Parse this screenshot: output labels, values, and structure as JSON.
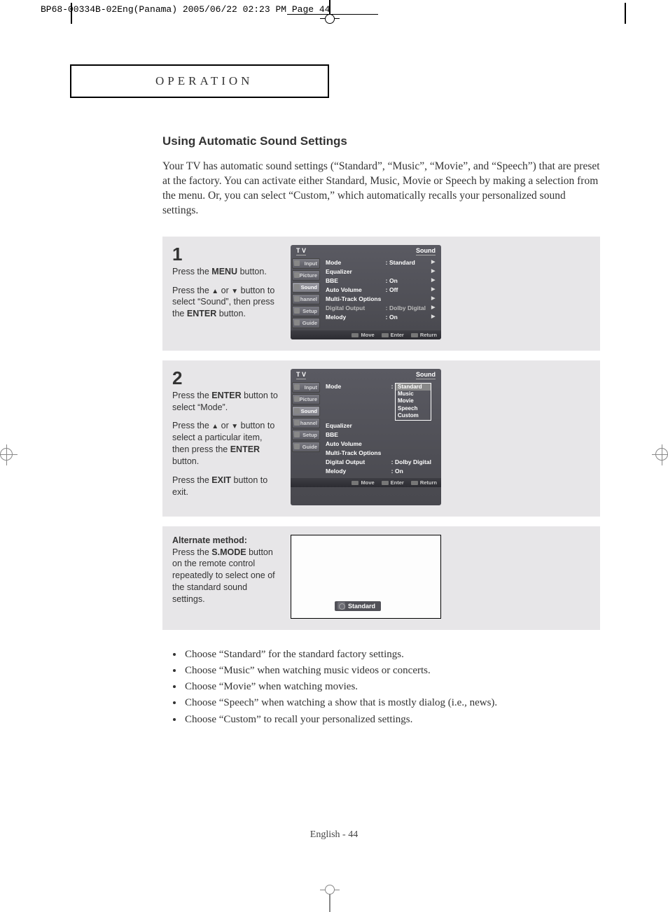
{
  "crop_header": "BP68-00334B-02Eng(Panama)  2005/06/22  02:23 PM  Page 44",
  "section_title": "OPERATION",
  "heading": "Using Automatic Sound Settings",
  "intro": "Your TV has automatic sound settings (“Standard”, “Music”, “Movie”, and “Speech”)  that are preset at the factory.  You can activate either Standard, Music, Movie or Speech by making a selection from the menu. Or, you can select “Custom,” which automatically recalls your personalized sound settings.",
  "steps": {
    "s1": {
      "num": "1",
      "p1a": "Press the ",
      "p1b": "MENU",
      "p1c": " button.",
      "p2a": "Press the ",
      "p2b": " or ",
      "p2c": " button to select “Sound”, then press the ",
      "p2d": "ENTER",
      "p2e": " button."
    },
    "s2": {
      "num": "2",
      "p1a": "Press the ",
      "p1b": "ENTER",
      "p1c": " button to select “Mode”.",
      "p2a": "Press the ",
      "p2b": " or ",
      "p2c": " button to select a particular item, then press the ",
      "p2d": "ENTER",
      "p2e": " button.",
      "p3a": "Press the ",
      "p3b": "EXIT",
      "p3c": " button to exit."
    },
    "alt": {
      "h": "Alternate method:",
      "a": "Press the ",
      "b": "S.MODE",
      "c": " button on the remote control repeatedly to select one of the standard sound settings."
    }
  },
  "osd": {
    "tv": "T V",
    "title": "Sound",
    "sidebar": [
      "Input",
      "Picture",
      "Sound",
      "Channel",
      "Setup",
      "Guide"
    ],
    "rows1": [
      {
        "label": "Mode",
        "val": "Standard",
        "boxed": true,
        "tri": true
      },
      {
        "label": "Equalizer",
        "val": "",
        "tri": true
      },
      {
        "label": "BBE",
        "val": "On",
        "tri": true
      },
      {
        "label": "Auto Volume",
        "val": "Off",
        "tri": true
      },
      {
        "label": "Multi-Track Options",
        "val": "",
        "tri": true
      },
      {
        "label": "Digital Output",
        "val": "Dolby Digital",
        "tri": true,
        "dim": true
      },
      {
        "label": "Melody",
        "val": "On",
        "tri": true
      }
    ],
    "rows2": [
      {
        "label": "Mode",
        "val": "Standard"
      },
      {
        "label": "Equalizer",
        "val": ""
      },
      {
        "label": "BBE",
        "val": ""
      },
      {
        "label": "Auto Volume",
        "val": ""
      },
      {
        "label": "Multi-Track Options",
        "val": ""
      },
      {
        "label": "Digital Output",
        "val": "Dolby Digital"
      },
      {
        "label": "Melody",
        "val": "On"
      }
    ],
    "dropdown": [
      "Standard",
      "Music",
      "Movie",
      "Speech",
      "Custom"
    ],
    "footer": {
      "move": "Move",
      "enter": "Enter",
      "return": "Return"
    }
  },
  "alt_box": "Standard",
  "bullets": [
    "Choose “Standard” for the standard factory settings.",
    "Choose “Music” when watching music videos or concerts.",
    "Choose “Movie” when watching movies.",
    "Choose “Speech” when watching a show that is mostly dialog (i.e., news).",
    "Choose “Custom” to recall your personalized settings."
  ],
  "footer": "English - 44"
}
